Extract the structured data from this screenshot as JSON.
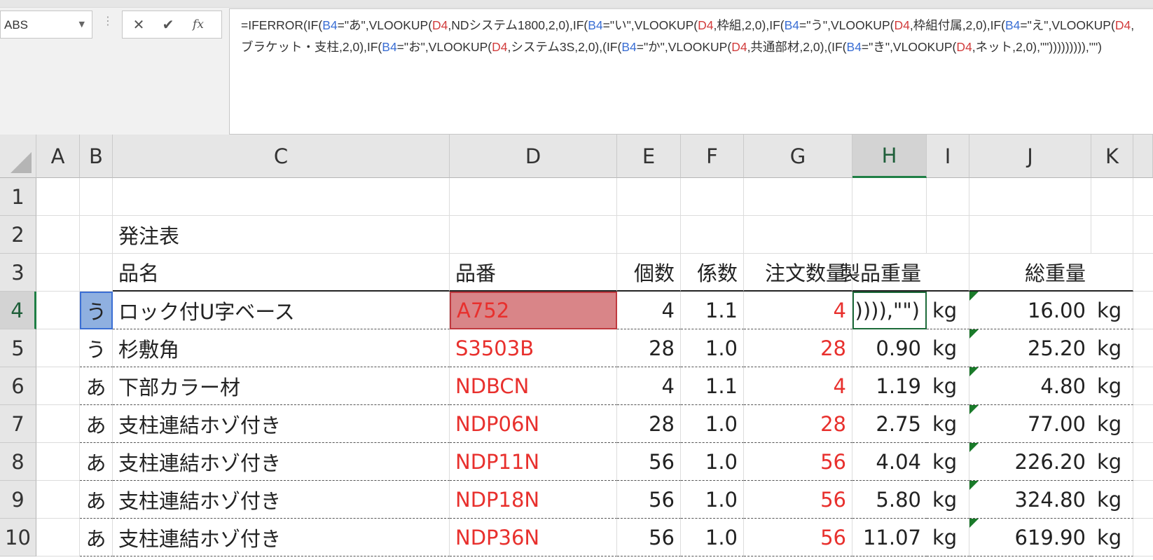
{
  "formula_bar": {
    "name_box": "ABS",
    "cancel_glyph": "✕",
    "enter_glyph": "✔",
    "fx_glyph": "fx",
    "formula_segments": [
      {
        "t": "=IFERROR(IF(",
        "k": "n"
      },
      {
        "t": "B4",
        "k": "b"
      },
      {
        "t": "=\"あ\",VLOOKUP(",
        "k": "n"
      },
      {
        "t": "D4",
        "k": "d"
      },
      {
        "t": ",NDシステム1800,2,0),IF(",
        "k": "n"
      },
      {
        "t": "B4",
        "k": "b"
      },
      {
        "t": "=\"い\",VLOOKUP(",
        "k": "n"
      },
      {
        "t": "D4",
        "k": "d"
      },
      {
        "t": ",枠組,2,0),IF(",
        "k": "n"
      },
      {
        "t": "B4",
        "k": "b"
      },
      {
        "t": "=\"う\",VLOOKUP(",
        "k": "n"
      },
      {
        "t": "D4",
        "k": "d"
      },
      {
        "t": ",枠組付属,2,0),IF(",
        "k": "n"
      },
      {
        "t": "B4",
        "k": "b"
      },
      {
        "t": "=\"え\",VLOOKUP(",
        "k": "n"
      },
      {
        "t": "D4",
        "k": "d"
      },
      {
        "t": ",ブラケット・支柱,2,0),IF(",
        "k": "n"
      },
      {
        "t": "B4",
        "k": "b"
      },
      {
        "t": "=\"お\",VLOOKUP(",
        "k": "n"
      },
      {
        "t": "D4",
        "k": "d"
      },
      {
        "t": ",システム3S,2,0),(IF(",
        "k": "n"
      },
      {
        "t": "B4",
        "k": "b"
      },
      {
        "t": "=\"か\",VLOOKUP(",
        "k": "n"
      },
      {
        "t": "D4",
        "k": "d"
      },
      {
        "t": ",共通部材,2,0),(IF(",
        "k": "n"
      },
      {
        "t": "B4",
        "k": "b"
      },
      {
        "t": "=\"き\",VLOOKUP(",
        "k": "n"
      },
      {
        "t": "D4",
        "k": "d"
      },
      {
        "t": ",ネット,2,0),\"\"))))))))),\"\")",
        "k": "n"
      }
    ]
  },
  "columns": [
    "A",
    "B",
    "C",
    "D",
    "E",
    "F",
    "G",
    "H",
    "I",
    "J",
    "K"
  ],
  "active_column": "H",
  "active_row": 4,
  "rows": [
    {
      "num": "1"
    },
    {
      "num": "2",
      "title": "発注表"
    },
    {
      "num": "3",
      "headers": {
        "c": "品名",
        "d": "品番",
        "e": "個数",
        "f": "係数",
        "g": "注文数量",
        "h": "製品重量",
        "j": "総重量"
      }
    },
    {
      "num": "4",
      "b": "う",
      "c": "ロック付U字ベース",
      "d": "A752",
      "e": "4",
      "f": "1.1",
      "g": "4",
      "h": ")))),\"\")",
      "i": "kg",
      "j": "16.00",
      "k": "kg"
    },
    {
      "num": "5",
      "b": "う",
      "c": "杉敷角",
      "d": "S3503B",
      "e": "28",
      "f": "1.0",
      "g": "28",
      "h": "0.90",
      "i": "kg",
      "j": "25.20",
      "k": "kg"
    },
    {
      "num": "6",
      "b": "あ",
      "c": "下部カラー材",
      "d": "NDBCN",
      "e": "4",
      "f": "1.1",
      "g": "4",
      "h": "1.19",
      "i": "kg",
      "j": "4.80",
      "k": "kg"
    },
    {
      "num": "7",
      "b": "あ",
      "c": "支柱連結ホゾ付き",
      "d": "NDP06N",
      "e": "28",
      "f": "1.0",
      "g": "28",
      "h": "2.75",
      "i": "kg",
      "j": "77.00",
      "k": "kg"
    },
    {
      "num": "8",
      "b": "あ",
      "c": "支柱連結ホゾ付き",
      "d": "NDP11N",
      "e": "56",
      "f": "1.0",
      "g": "56",
      "h": "4.04",
      "i": "kg",
      "j": "226.20",
      "k": "kg"
    },
    {
      "num": "9",
      "b": "あ",
      "c": "支柱連結ホゾ付き",
      "d": "NDP18N",
      "e": "56",
      "f": "1.0",
      "g": "56",
      "h": "5.80",
      "i": "kg",
      "j": "324.80",
      "k": "kg"
    },
    {
      "num": "10",
      "b": "あ",
      "c": "支柱連結ホゾ付き",
      "d": "NDP36N",
      "e": "56",
      "f": "1.0",
      "g": "56",
      "h": "11.07",
      "i": "kg",
      "j": "619.90",
      "k": "kg"
    }
  ]
}
